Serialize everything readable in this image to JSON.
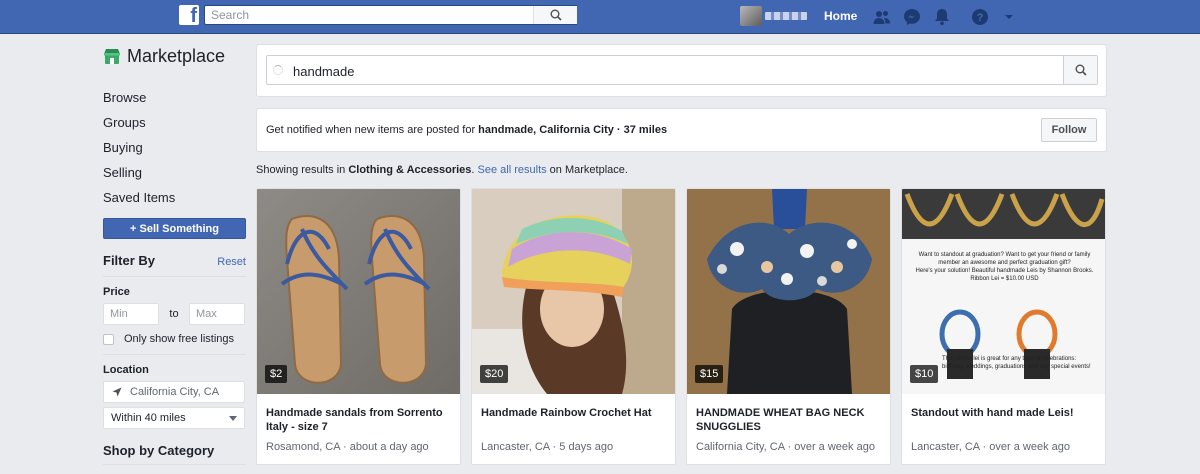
{
  "topbar": {
    "search_placeholder": "Search",
    "home_label": "Home",
    "brand_color": "#4267b2"
  },
  "sidebar": {
    "title": "Marketplace",
    "nav": [
      "Browse",
      "Groups",
      "Buying",
      "Selling",
      "Saved Items"
    ],
    "sell_button": "+ Sell Something",
    "filter_title": "Filter By",
    "reset": "Reset",
    "price_label": "Price",
    "min_placeholder": "Min",
    "to_label": "to",
    "max_placeholder": "Max",
    "free_listings": "Only show free listings",
    "location_label": "Location",
    "location_value": "California City, CA",
    "radius_value": "Within 40 miles",
    "shop_by_category": "Shop by Category"
  },
  "search": {
    "query": "handmade"
  },
  "notify": {
    "prefix": "Get notified when new items are posted for ",
    "bold": "handmade, California City · 37 miles",
    "follow": "Follow"
  },
  "results": {
    "prefix": "Showing results in ",
    "category": "Clothing & Accessories",
    "separator": ". ",
    "see_all": "See all results",
    "suffix": " on Marketplace."
  },
  "listings": [
    {
      "price": "$2",
      "title": "Handmade sandals from Sorrento Italy - size 7",
      "location": "Rosamond, CA",
      "time": "about a day ago"
    },
    {
      "price": "$20",
      "title": "Handmade Rainbow Crochet Hat",
      "location": "Lancaster, CA",
      "time": "5 days ago"
    },
    {
      "price": "$15",
      "title": "HANDMADE WHEAT BAG NECK SNUGGLIES",
      "location": "California City, CA",
      "time": "over a week ago"
    },
    {
      "price": "$10",
      "title": "Standout with hand made Leis!",
      "location": "Lancaster, CA",
      "time": "over a week ago"
    }
  ],
  "flyer": {
    "line1": "Want to standout at graduation? Want to get your friend or family member an awesome and perfect graduation gift?",
    "line2": "Here's your solution! Beautiful handmade Leis by Shannon Brooks.",
    "line3": "Ribbon Lei = $10.00 USD",
    "line4": "This ribbon lei is great for any type of celebrations: birthday, weddings, graduations and any special events!"
  }
}
